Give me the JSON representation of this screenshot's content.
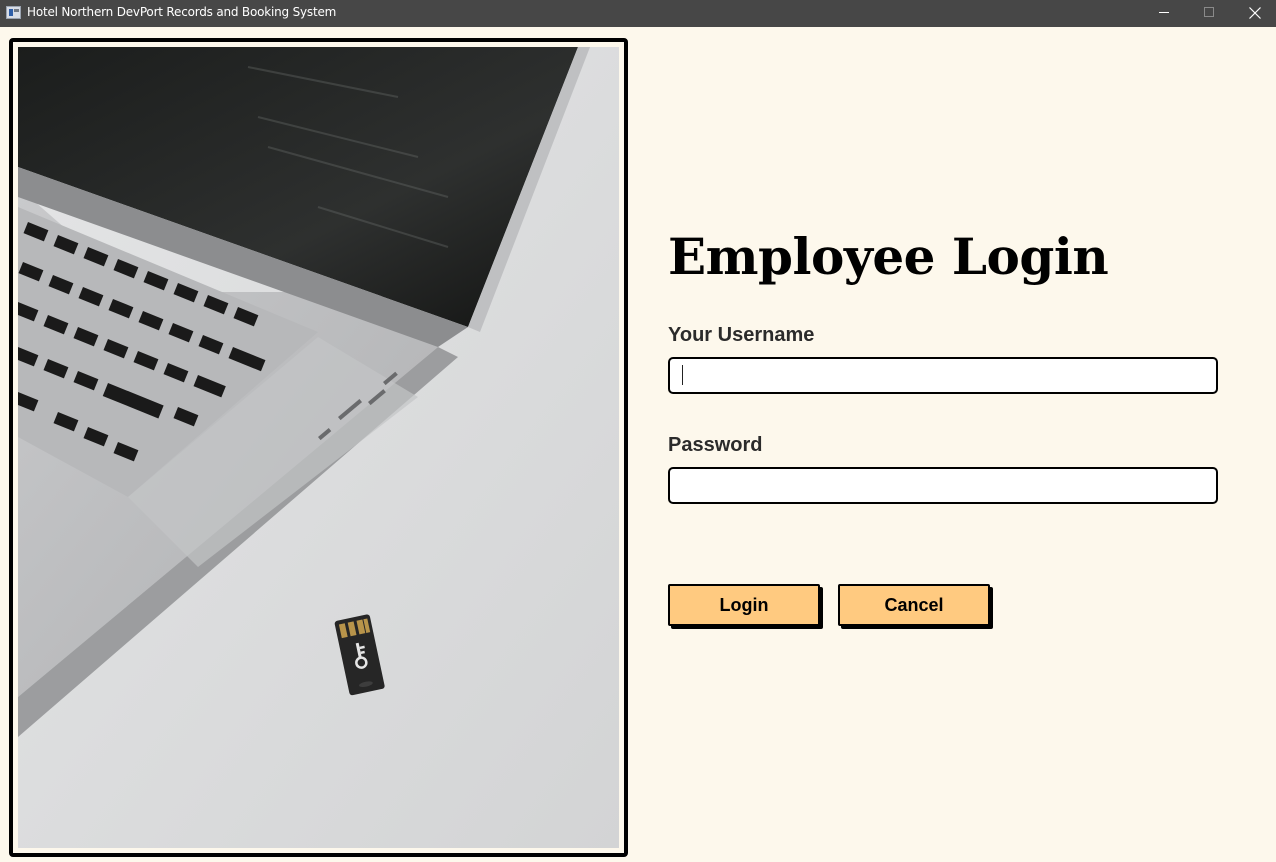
{
  "window": {
    "title": "Hotel Northern DevPort Records and Booking System"
  },
  "illustration": {
    "description_icon": "laptop-with-usb-key-photo"
  },
  "login": {
    "heading": "Employee Login",
    "username_label": "Your Username",
    "username_value": "",
    "password_label": "Password",
    "password_value": "",
    "login_button": "Login",
    "cancel_button": "Cancel"
  },
  "colors": {
    "background": "#fdf8ec",
    "titlebar": "#474747",
    "button": "#ffca80"
  }
}
